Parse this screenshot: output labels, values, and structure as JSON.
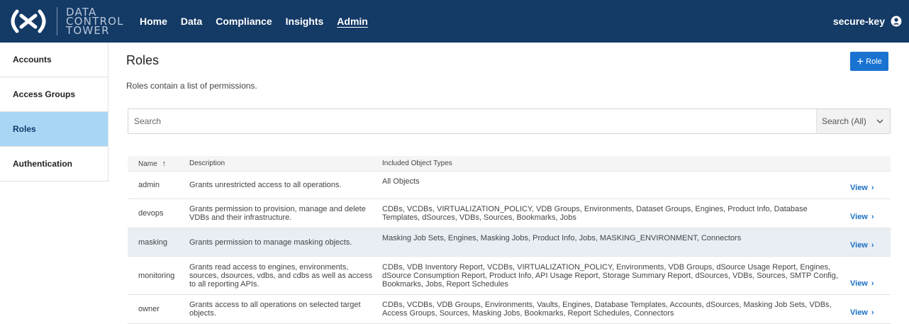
{
  "header": {
    "logo_symbol": "(x)",
    "logo_lines": [
      "DATA",
      "CONTROL",
      "TOWER"
    ],
    "nav": [
      "Home",
      "Data",
      "Compliance",
      "Insights",
      "Admin"
    ],
    "active_nav": "Admin",
    "user": "secure-key",
    "bg_color": "#143a66"
  },
  "sidebar": {
    "items": [
      {
        "label": "Accounts"
      },
      {
        "label": "Access Groups"
      },
      {
        "label": "Roles"
      },
      {
        "label": "Authentication"
      }
    ],
    "active": "Roles"
  },
  "main": {
    "title": "Roles",
    "subtitle": "Roles contain a list of permissions.",
    "add_button": "Role",
    "search": {
      "placeholder": "Search",
      "scope": "Search (All)"
    },
    "table": {
      "headers": {
        "name": "Name",
        "description": "Description",
        "types": "Included Object Types",
        "sort_icon": "↑"
      },
      "view_label": "View",
      "rows": [
        {
          "name": "admin",
          "description": "Grants unrestricted access to all operations.",
          "types": "All Objects"
        },
        {
          "name": "devops",
          "description": "Grants permission to provision, manage and delete VDBs and their infrastructure.",
          "types": "CDBs, VCDBs, VIRTUALIZATION_POLICY, VDB Groups, Environments, Dataset Groups, Engines, Product Info, Database Templates, dSources, VDBs, Sources, Bookmarks, Jobs"
        },
        {
          "name": "masking",
          "description": "Grants permission to manage masking objects.",
          "types": "Masking Job Sets, Engines, Masking Jobs, Product Info, Jobs, MASKING_ENVIRONMENT, Connectors"
        },
        {
          "name": "monitoring",
          "description": "Grants read access to engines, environments, sources, dsources, vdbs, and cdbs as well as access to all reporting APIs.",
          "types": "CDBs, VDB Inventory Report, VCDBs, VIRTUALIZATION_POLICY, Environments, VDB Groups, dSource Usage Report, Engines, dSource Consumption Report, Product Info, API Usage Report, Storage Summary Report, dSources, VDBs, Sources, SMTP Config, Bookmarks, Jobs, Report Schedules"
        },
        {
          "name": "owner",
          "description": "Grants access to all operations on selected target objects.",
          "types": "CDBs, VCDBs, VDB Groups, Environments, Vaults, Engines, Database Templates, Accounts, dSources, Masking Job Sets, VDBs, Access Groups, Sources, Masking Jobs, Bookmarks, Report Schedules, Connectors"
        }
      ]
    }
  }
}
